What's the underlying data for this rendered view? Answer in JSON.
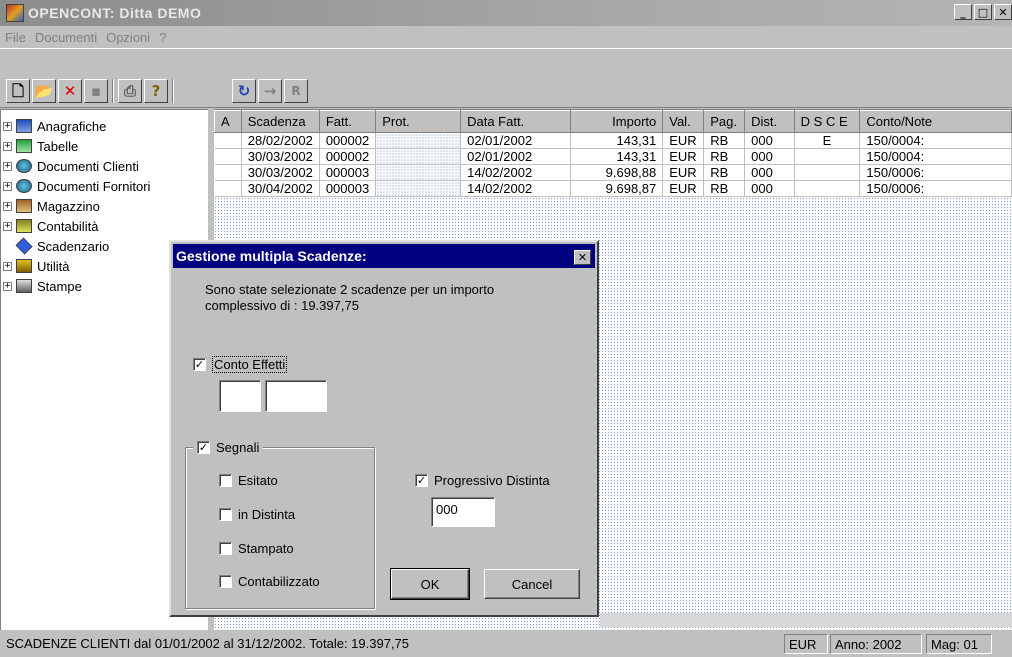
{
  "window": {
    "title": "OPENCONT: Ditta DEMO",
    "min_glyph": "_",
    "max_glyph": "□",
    "close_glyph": "✕"
  },
  "menu": {
    "file": "File",
    "documenti": "Documenti",
    "opzioni": "Opzioni",
    "help": "?"
  },
  "toolbar": {
    "new": "🗋",
    "open": "📂",
    "delete": "✕",
    "save": "▪",
    "print": "⎙",
    "help": "?",
    "refresh": "↻",
    "next": "→",
    "report": "R"
  },
  "tree": {
    "items": [
      {
        "label": "Anagrafiche",
        "expander": "+"
      },
      {
        "label": "Tabelle",
        "expander": "+"
      },
      {
        "label": "Documenti Clienti",
        "expander": "+"
      },
      {
        "label": "Documenti Fornitori",
        "expander": "+"
      },
      {
        "label": "Magazzino",
        "expander": "+"
      },
      {
        "label": "Contabilità",
        "expander": "+"
      },
      {
        "label": "Scadenzario",
        "expander": ""
      },
      {
        "label": "Utilità",
        "expander": "+"
      },
      {
        "label": "Stampe",
        "expander": "+"
      }
    ]
  },
  "grid": {
    "headers": [
      "A",
      "Scadenza",
      "Fatt.",
      "Prot.",
      "Data Fatt.",
      "Importo",
      "Val.",
      "Pag.",
      "Dist.",
      "D S C E",
      "Conto/Note"
    ],
    "rows": [
      [
        "",
        "28/02/2002",
        "000002",
        "",
        "02/01/2002",
        "143,31",
        "EUR",
        "RB",
        "000",
        "E",
        "150/0004:"
      ],
      [
        "",
        "30/03/2002",
        "000002",
        "",
        "02/01/2002",
        "143,31",
        "EUR",
        "RB",
        "000",
        "",
        "150/0004:"
      ],
      [
        "",
        "30/03/2002",
        "000003",
        "",
        "14/02/2002",
        "9.698,88",
        "EUR",
        "RB",
        "000",
        "",
        "150/0006:"
      ],
      [
        "",
        "30/04/2002",
        "000003",
        "",
        "14/02/2002",
        "9.698,87",
        "EUR",
        "RB",
        "000",
        "",
        "150/0006:"
      ]
    ]
  },
  "dialog": {
    "title": "Gestione multipla Scadenze:",
    "close_glyph": "✕",
    "message_line1": "Sono state selezionate 2 scadenze per un importo",
    "message_line2": "complessivo di :    19.397,75",
    "conto_effetti": {
      "label": "Conto Effetti",
      "checked": true,
      "field1": "",
      "field2": ""
    },
    "segnali": {
      "label": "Segnali",
      "checked": true,
      "esitato": {
        "label": "Esitato",
        "checked": false
      },
      "in_distinta": {
        "label": "in Distinta",
        "checked": false
      },
      "stampato": {
        "label": "Stampato",
        "checked": false
      },
      "contabilizzato": {
        "label": "Contabilizzato",
        "checked": false
      }
    },
    "progressivo": {
      "label": "Progressivo Distinta",
      "checked": true,
      "value": "000"
    },
    "ok": "OK",
    "cancel": "Cancel",
    "check_glyph": "✓"
  },
  "status": {
    "main": "SCADENZE CLIENTI dal 01/01/2002 al 31/12/2002. Totale:      19.397,75",
    "currency": "EUR",
    "anno": "Anno: 2002",
    "mag": "Mag: 01"
  }
}
